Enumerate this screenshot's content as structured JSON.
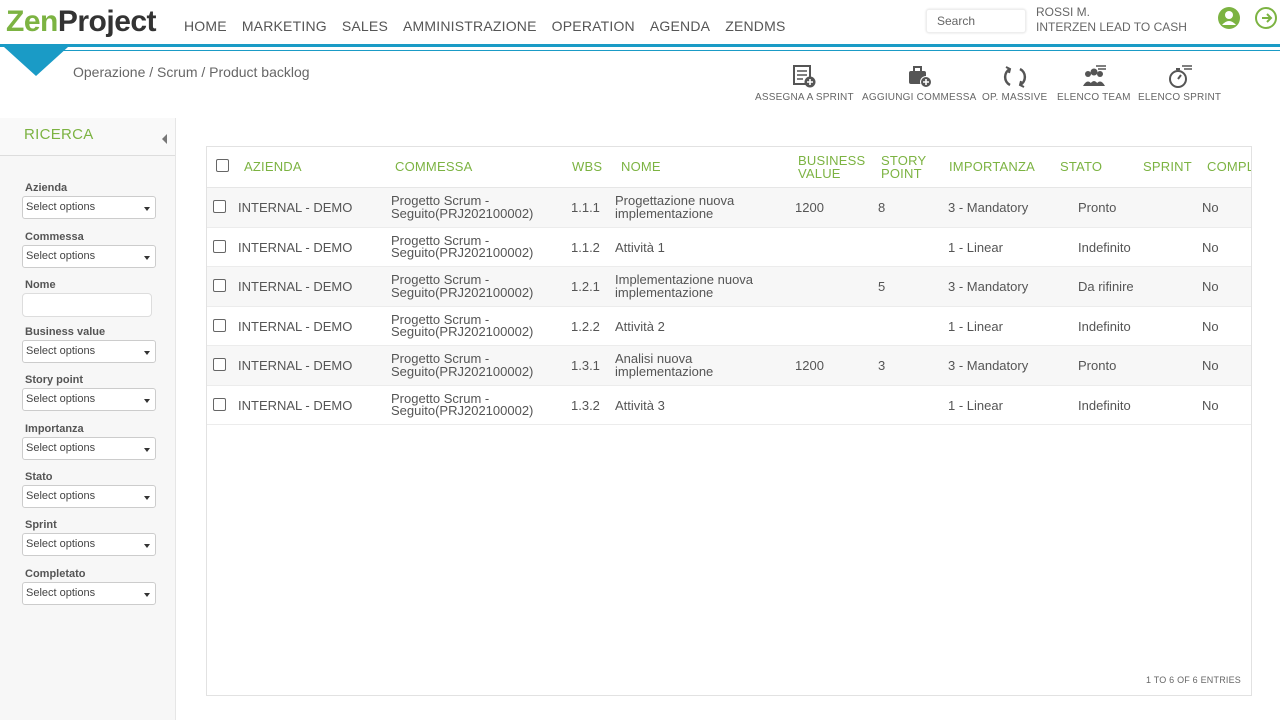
{
  "brand": {
    "zen": "Zen",
    "project": "Project"
  },
  "nav": [
    "HOME",
    "MARKETING",
    "SALES",
    "AMMINISTRAZIONE",
    "OPERATION",
    "AGENDA",
    "ZENDMS"
  ],
  "search": {
    "placeholder": "Search"
  },
  "user": {
    "name": "ROSSI M.",
    "company": "INTERZEN LEAD TO CASH"
  },
  "breadcrumb": "Operazione / Scrum / Product backlog",
  "toolbar": [
    "ASSEGNA A SPRINT",
    "AGGIUNGI COMMESSA",
    "OP. MASSIVE",
    "ELENCO TEAM",
    "ELENCO SPRINT"
  ],
  "sidebar": {
    "title": "RICERCA",
    "filters": [
      {
        "label": "Azienda",
        "value": "Select options"
      },
      {
        "label": "Commessa",
        "value": "Select options"
      },
      {
        "label": "Nome",
        "value": ""
      },
      {
        "label": "Business value",
        "value": "Select options"
      },
      {
        "label": "Story point",
        "value": "Select options"
      },
      {
        "label": "Importanza",
        "value": "Select options"
      },
      {
        "label": "Stato",
        "value": "Select options"
      },
      {
        "label": "Sprint",
        "value": "Select options"
      },
      {
        "label": "Completato",
        "value": "Select options"
      }
    ]
  },
  "table": {
    "headers": [
      "AZIENDA",
      "COMMESSA",
      "WBS",
      "NOME",
      "BUSINESS VALUE",
      "STORY POINT",
      "IMPORTANZA",
      "STATO",
      "SPRINT",
      "COMPL"
    ],
    "rows": [
      {
        "azienda": "INTERNAL - DEMO",
        "commessa1": "Progetto Scrum -",
        "commessa2": "Seguito(PRJ202100002)",
        "wbs": "1.1.1",
        "nome1": "Progettazione nuova",
        "nome2": "implementazione",
        "bv": "1200",
        "sp": "8",
        "importanza": "3 - Mandatory",
        "stato": "Pronto",
        "sprint": "",
        "compl": "No"
      },
      {
        "azienda": "INTERNAL - DEMO",
        "commessa1": "Progetto Scrum -",
        "commessa2": "Seguito(PRJ202100002)",
        "wbs": "1.1.2",
        "nome1": "Attività 1",
        "nome2": "",
        "bv": "",
        "sp": "",
        "importanza": "1 - Linear",
        "stato": "Indefinito",
        "sprint": "",
        "compl": "No"
      },
      {
        "azienda": "INTERNAL - DEMO",
        "commessa1": "Progetto Scrum -",
        "commessa2": "Seguito(PRJ202100002)",
        "wbs": "1.2.1",
        "nome1": "Implementazione nuova",
        "nome2": "implementazione",
        "bv": "",
        "sp": "5",
        "importanza": "3 - Mandatory",
        "stato": "Da rifinire",
        "sprint": "",
        "compl": "No"
      },
      {
        "azienda": "INTERNAL - DEMO",
        "commessa1": "Progetto Scrum -",
        "commessa2": "Seguito(PRJ202100002)",
        "wbs": "1.2.2",
        "nome1": "Attività 2",
        "nome2": "",
        "bv": "",
        "sp": "",
        "importanza": "1 - Linear",
        "stato": "Indefinito",
        "sprint": "",
        "compl": "No"
      },
      {
        "azienda": "INTERNAL - DEMO",
        "commessa1": "Progetto Scrum -",
        "commessa2": "Seguito(PRJ202100002)",
        "wbs": "1.3.1",
        "nome1": "Analisi nuova",
        "nome2": "implementazione",
        "bv": "1200",
        "sp": "3",
        "importanza": "3 - Mandatory",
        "stato": "Pronto",
        "sprint": "",
        "compl": "No"
      },
      {
        "azienda": "INTERNAL - DEMO",
        "commessa1": "Progetto Scrum -",
        "commessa2": "Seguito(PRJ202100002)",
        "wbs": "1.3.2",
        "nome1": "Attività 3",
        "nome2": "",
        "bv": "",
        "sp": "",
        "importanza": "1 - Linear",
        "stato": "Indefinito",
        "sprint": "",
        "compl": "No"
      }
    ],
    "info": "1 TO 6 OF 6 ENTRIES"
  },
  "colors": {
    "accent": "#7cb342",
    "teal": "#1a9bc6"
  }
}
